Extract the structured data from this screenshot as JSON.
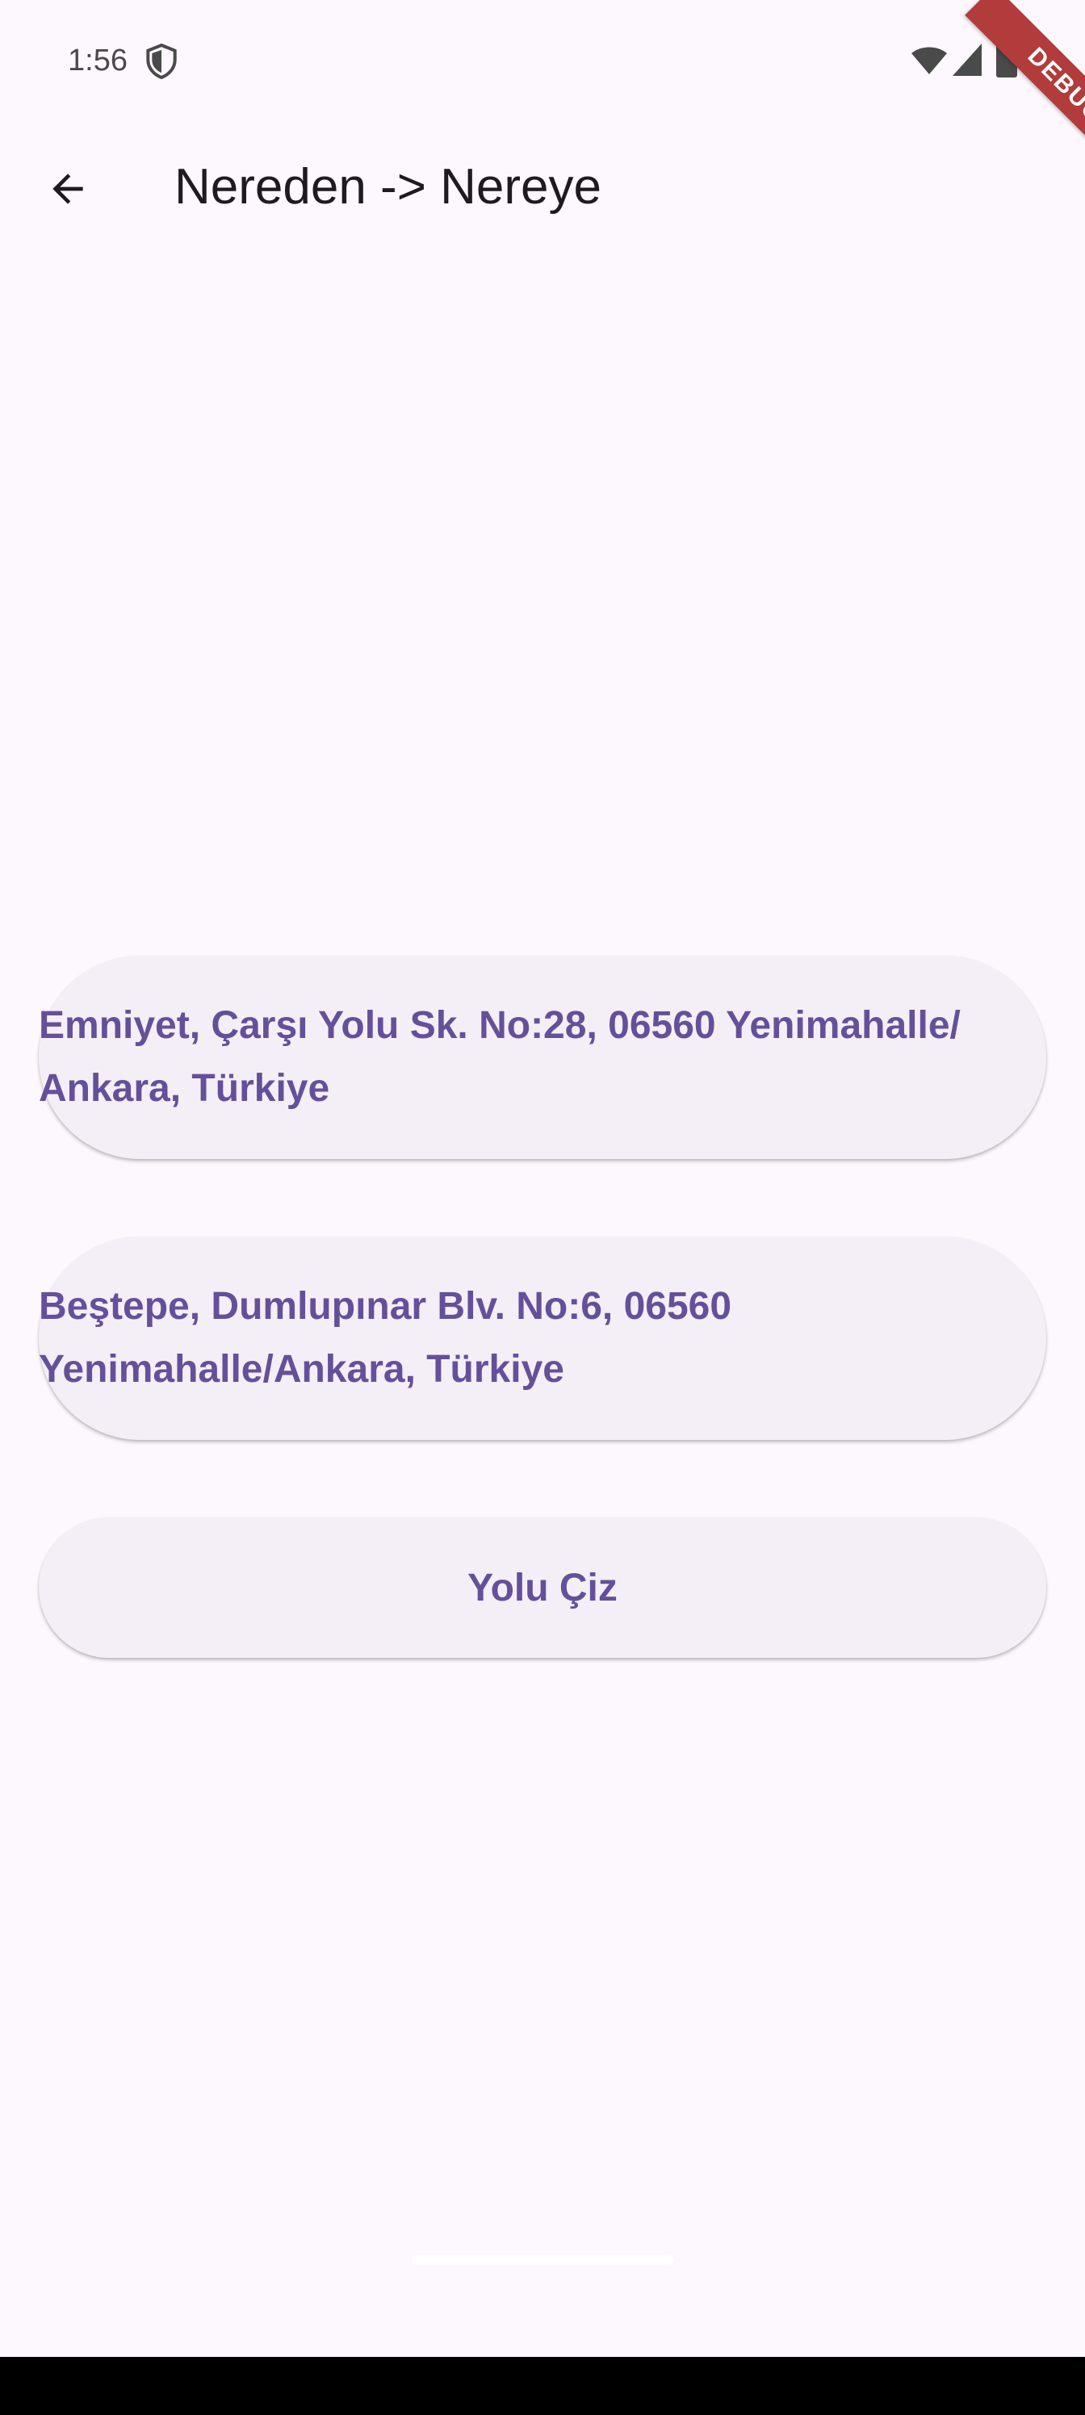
{
  "status_bar": {
    "time": "1:56"
  },
  "debug_banner": "DEBUG",
  "app_bar": {
    "title": "Nereden -> Nereye"
  },
  "form": {
    "origin_value": "Emniyet, Çarşı Yolu Sk. No:28, 06560 Yenimahalle/ Ankara, Türkiye",
    "destination_value": "Beştepe, Dumlupınar Blv. No:6, 06560 Yenimahalle/Ankara, Türkiye",
    "draw_route_label": "Yolu Çiz"
  },
  "colors": {
    "background": "#FDF7FE",
    "field_background": "#F4EFF6",
    "accent_text": "#64509A",
    "title_text": "#1D1B20",
    "debug_ribbon": "#B23B3B"
  },
  "icons": {
    "back": "arrow-back-icon",
    "status_shield": "shield-icon",
    "wifi": "wifi-icon",
    "signal": "signal-icon",
    "battery": "battery-icon"
  }
}
